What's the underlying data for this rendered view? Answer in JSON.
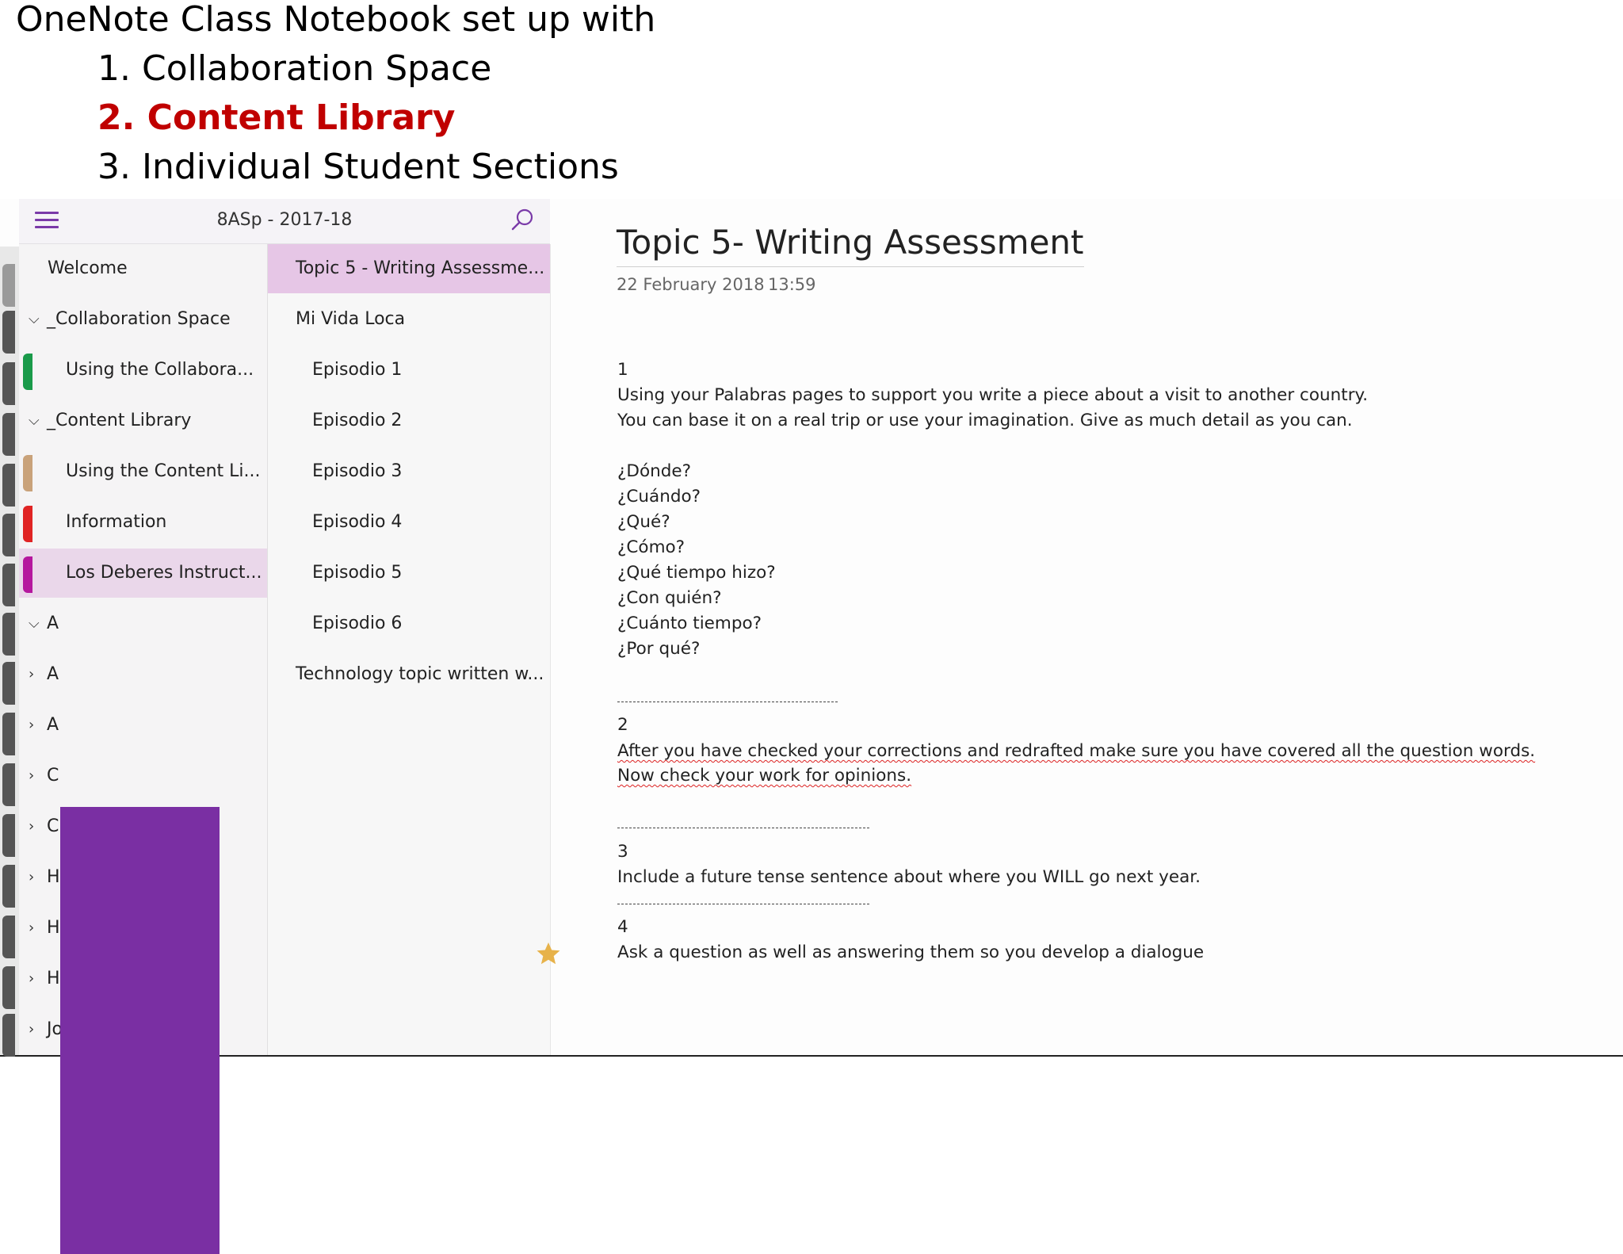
{
  "slide": {
    "title": "OneNote Class Notebook set up with",
    "items": [
      "1. Collaboration Space",
      "2. Content Library",
      "3. Individual Student Sections"
    ]
  },
  "app": {
    "notebook_name": "8ASp - 2017-18",
    "sections": [
      {
        "label": "Welcome"
      },
      {
        "label": "_Collaboration Space"
      },
      {
        "label": "Using the Collabora..."
      },
      {
        "label": "_Content Library"
      },
      {
        "label": "Using the Content Li..."
      },
      {
        "label": "Information"
      },
      {
        "label": "Los Deberes Instruct..."
      },
      {
        "label": "A"
      },
      {
        "label": "A"
      },
      {
        "label": "A"
      },
      {
        "label": "C"
      },
      {
        "label": "C"
      },
      {
        "label": "H"
      },
      {
        "label": "H"
      },
      {
        "label": "H"
      },
      {
        "label": "Jo"
      }
    ],
    "section_colors": {
      "collab": "#1a9a4a",
      "content": "#c9a27a",
      "info": "#e02424",
      "deberes": "#b5179e"
    },
    "pages": [
      {
        "label": "Topic 5 - Writing Assessme..."
      },
      {
        "label": "Mi Vida Loca"
      },
      {
        "label": "Episodio 1"
      },
      {
        "label": "Episodio 2"
      },
      {
        "label": "Episodio 3"
      },
      {
        "label": "Episodio 4"
      },
      {
        "label": "Episodio 5"
      },
      {
        "label": "Episodio 6"
      },
      {
        "label": "Technology topic written w..."
      }
    ],
    "page": {
      "title": "Topic 5- Writing Assessment",
      "date": "22 February 2018",
      "time": "13:59",
      "p1_num": "1",
      "p1_l1": "Using your Palabras pages to support you write a piece about a visit to another country.",
      "p1_l2": "You can base it on a real trip or use your imagination. Give as much detail as you can.",
      "questions": [
        "¿Dónde?",
        "¿Cuándo?",
        "¿Qué?",
        "¿Cómo?",
        "¿Qué tiempo hizo?",
        "¿Con quién?",
        "¿Cuánto tiempo?",
        "¿Por qué?"
      ],
      "p2_num": "2",
      "p2_l1": "After you have checked your corrections and redrafted make sure you have covered all the question words.",
      "p2_l2": "Now check your work for opinions.",
      "p3_num": "3",
      "p3_l1": "Include a future tense sentence about where you WILL go next year.",
      "p4_num": "4",
      "p4_l1": "Ask a question as well as answering them so you develop a dialogue"
    }
  }
}
